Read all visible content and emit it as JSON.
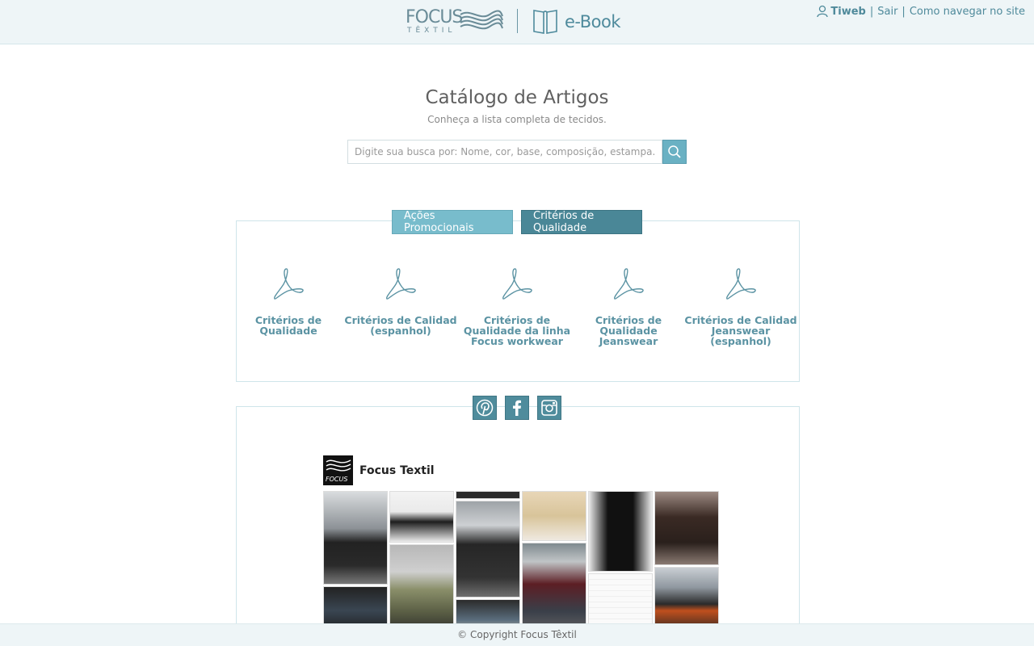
{
  "header": {
    "logo_word": "FOCUS",
    "logo_sub": "TÊXTIL",
    "ebook_label": "e-Book",
    "user_name": "Tiweb",
    "sep1": "|",
    "logout_label": "Sair",
    "sep2": "|",
    "help_label": "Como navegar no site"
  },
  "hero": {
    "title": "Catálogo de Artigos",
    "subtitle": "Conheça a lista completa de tecidos.",
    "search_placeholder": "Digite sua busca por: Nome, cor, base, composição, estampa..."
  },
  "tabs": [
    {
      "label": "Ações Promocionais",
      "active": false
    },
    {
      "label": "Critérios de Qualidade",
      "active": true
    }
  ],
  "documents": [
    {
      "label": "Critérios de Qualidade"
    },
    {
      "label": "Critérios de Calidad (espanhol)"
    },
    {
      "label": "Critérios de Qualidade da linha Focus workwear"
    },
    {
      "label": "Critérios de Qualidade Jeanswear"
    },
    {
      "label": "Critérios de Calidad Jeanswear (espanhol)"
    }
  ],
  "social": {
    "icons": [
      "pinterest-icon",
      "facebook-icon",
      "instagram-icon"
    ]
  },
  "widget": {
    "name": "Focus Textil",
    "avatar_text": "FOCUS"
  },
  "footer": {
    "copyright": "© Copyright Focus Têxtil"
  },
  "colors": {
    "accent": "#4f8c9c",
    "accent_light": "#78bccc",
    "link": "#5b93a3",
    "header_bg": "#eef5f7"
  }
}
